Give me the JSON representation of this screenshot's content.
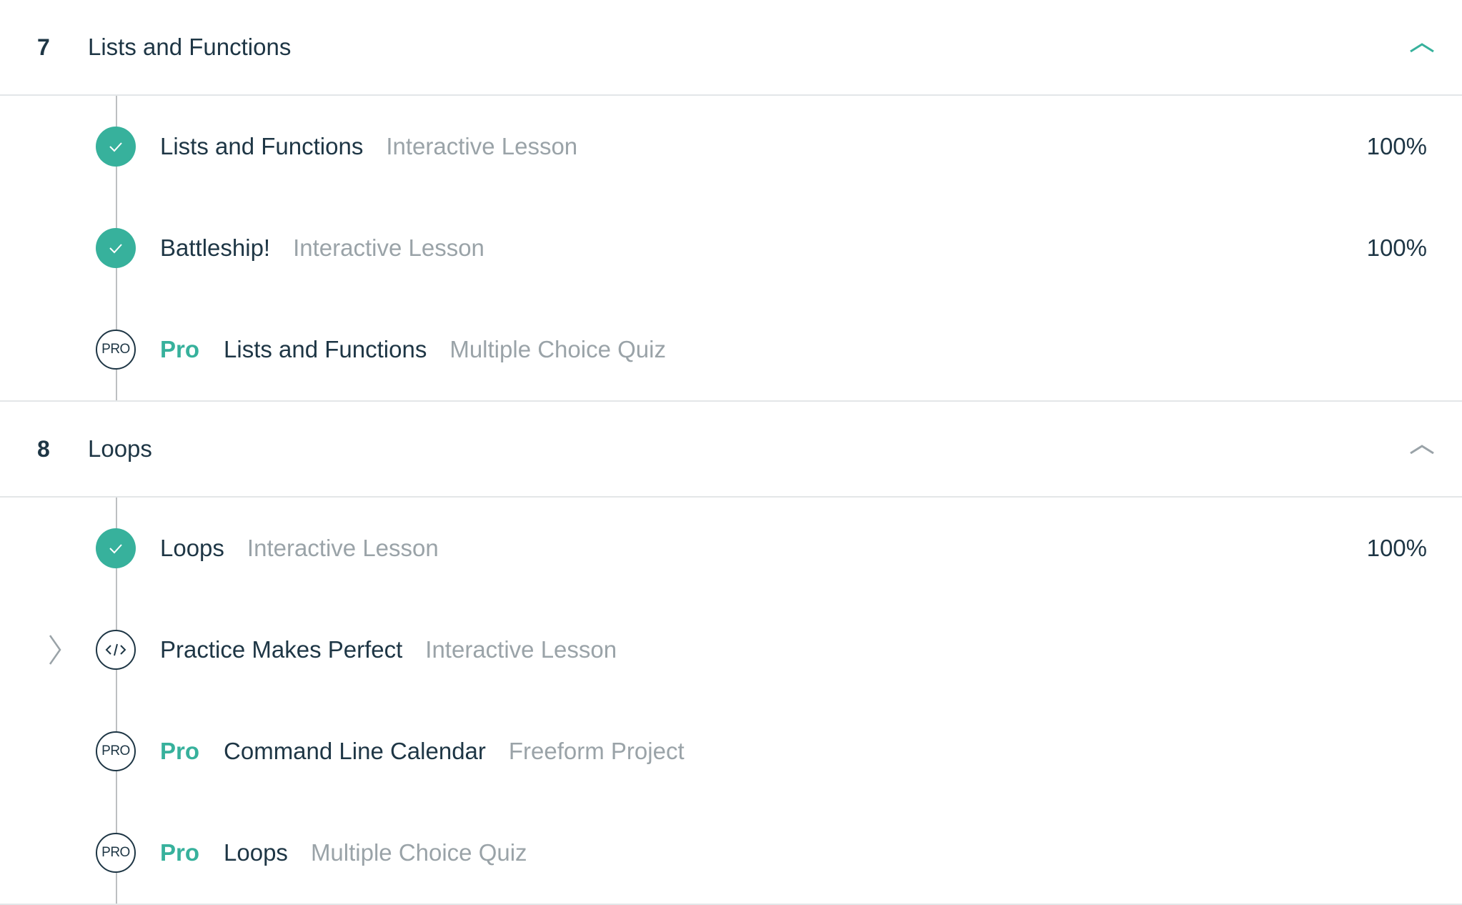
{
  "colors": {
    "accent": "#37b19c",
    "text": "#1e3645",
    "muted": "#9aa3a8",
    "divider": "#e3e6e8"
  },
  "sections": [
    {
      "number": "7",
      "title": "Lists and Functions",
      "toggle_icon": "chevron-up-icon",
      "toggle_color": "#37b19c",
      "items": [
        {
          "status": "completed",
          "icon": "check-icon",
          "pro_label": "",
          "title": "Lists and Functions",
          "type": "Interactive Lesson",
          "progress": "100%"
        },
        {
          "status": "completed",
          "icon": "check-icon",
          "pro_label": "",
          "title": "Battleship!",
          "type": "Interactive Lesson",
          "progress": "100%"
        },
        {
          "status": "pro",
          "icon_label": "PRO",
          "pro_label": "Pro",
          "title": "Lists and Functions",
          "type": "Multiple Choice Quiz",
          "progress": ""
        }
      ]
    },
    {
      "number": "8",
      "title": "Loops",
      "toggle_icon": "chevron-up-icon",
      "toggle_color": "#9aa3a8",
      "items": [
        {
          "status": "completed",
          "icon": "check-icon",
          "pro_label": "",
          "title": "Loops",
          "type": "Interactive Lesson",
          "progress": "100%"
        },
        {
          "status": "current",
          "icon": "code-icon",
          "pro_label": "",
          "title": "Practice Makes Perfect",
          "type": "Interactive Lesson",
          "progress": ""
        },
        {
          "status": "pro",
          "icon_label": "PRO",
          "pro_label": "Pro",
          "title": "Command Line Calendar",
          "type": "Freeform Project",
          "progress": ""
        },
        {
          "status": "pro",
          "icon_label": "PRO",
          "pro_label": "Pro",
          "title": "Loops",
          "type": "Multiple Choice Quiz",
          "progress": ""
        }
      ]
    }
  ]
}
